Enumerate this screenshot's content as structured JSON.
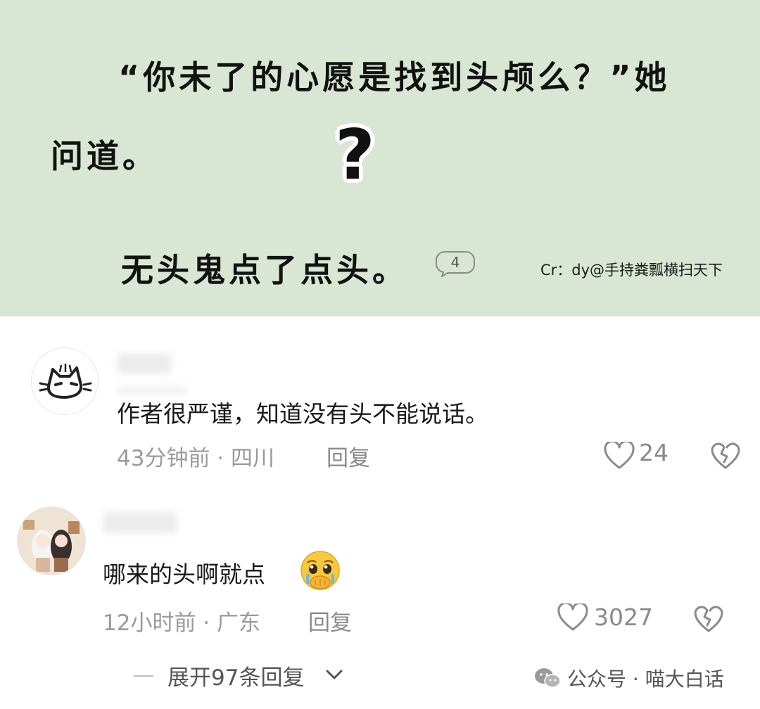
{
  "story": {
    "line1": "“你未了的心愿是找到头颅么？”她",
    "line2": "问道。",
    "question_mark": "?",
    "line3": "无头鬼点了点头。",
    "bubble_count": "4",
    "credit": "Cr：dy@手持粪瓢横扫天下"
  },
  "comments": [
    {
      "text": "作者很严谨，知道没有头不能说话。",
      "time_location": "43分钟前 · 四川",
      "reply_label": "回复",
      "likes": "24"
    },
    {
      "text": "哪来的头啊就点",
      "time_location": "12小时前 · 广东",
      "reply_label": "回复",
      "likes": "3027"
    }
  ],
  "expand_replies": "展开97条回复",
  "watermark": "公众号 · 喵大白话",
  "colors": {
    "story_bg": "#d9e6d3",
    "meta_gray": "#9a9a9a"
  }
}
